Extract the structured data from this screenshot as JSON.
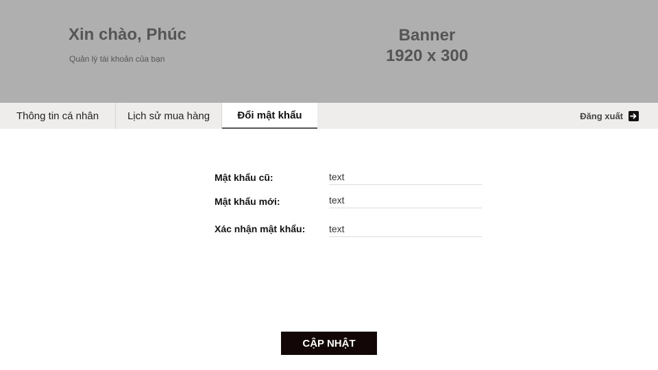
{
  "header": {
    "greeting": "Xin chào, Phúc",
    "subtitle": "Quản lý tài khoản của bạn",
    "banner_line1": "Banner",
    "banner_line2": "1920 x 300"
  },
  "tabs": [
    {
      "label": "Thông tin cá nhân",
      "active": false
    },
    {
      "label": "Lịch sử mua hàng",
      "active": false
    },
    {
      "label": "Đổi mật khẩu",
      "active": true
    }
  ],
  "logout": {
    "label": "Đăng xuất",
    "icon": "logout-arrow-icon"
  },
  "form": {
    "old_password": {
      "label": "Mật khẩu cũ:",
      "value": "text"
    },
    "new_password": {
      "label": "Mật khẩu mới:",
      "value": "text"
    },
    "confirm_password": {
      "label": "Xác nhận mật khẩu:",
      "value": "text"
    }
  },
  "submit": {
    "label": "CẬP NHẬT"
  },
  "colors": {
    "banner_bg": "#afafaf",
    "tabbar_bg": "#eeedec",
    "button_bg": "#120606"
  }
}
